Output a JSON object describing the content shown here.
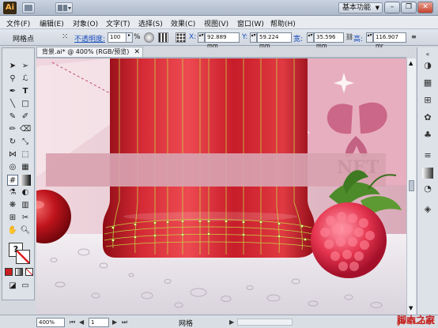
{
  "titlebar": {
    "logo": "Ai",
    "workspace_label": "基本功能",
    "workspace_arrow": "▼",
    "search_icon": "search-icon",
    "minimize": "–",
    "restore": "❐",
    "close": "✕"
  },
  "menu": [
    "文件(F)",
    "编辑(E)",
    "对象(O)",
    "文字(T)",
    "选择(S)",
    "效果(C)",
    "视图(V)",
    "窗口(W)",
    "帮助(H)"
  ],
  "control": {
    "tool_name": "网格点",
    "opacity_label": "不透明度:",
    "opacity_value": "100",
    "opacity_unit": "%",
    "x_label": "X:",
    "x_value": "92.889 mm",
    "y_label": "Y:",
    "y_value": "59.224 mm",
    "w_label": "宽:",
    "w_value": "35.596 mm",
    "h_label": "高:",
    "h_value": "116.907 mr"
  },
  "document": {
    "tab_title": "背景.ai* @ 400% (RGB/预览)",
    "close": "✕"
  },
  "canvas": {
    "watermark_text": "NET",
    "colors": {
      "background_pink": "#e6c8d1",
      "bottle_red": "#c81e2b",
      "mesh_line": "#c8e048",
      "raspberry": "#e5344f",
      "leaf_green": "#4d8a2a"
    }
  },
  "status": {
    "zoom": "400%",
    "page": "1",
    "text": "网格"
  },
  "watermark": {
    "url": "jb51.net",
    "name": "脚本之家"
  }
}
